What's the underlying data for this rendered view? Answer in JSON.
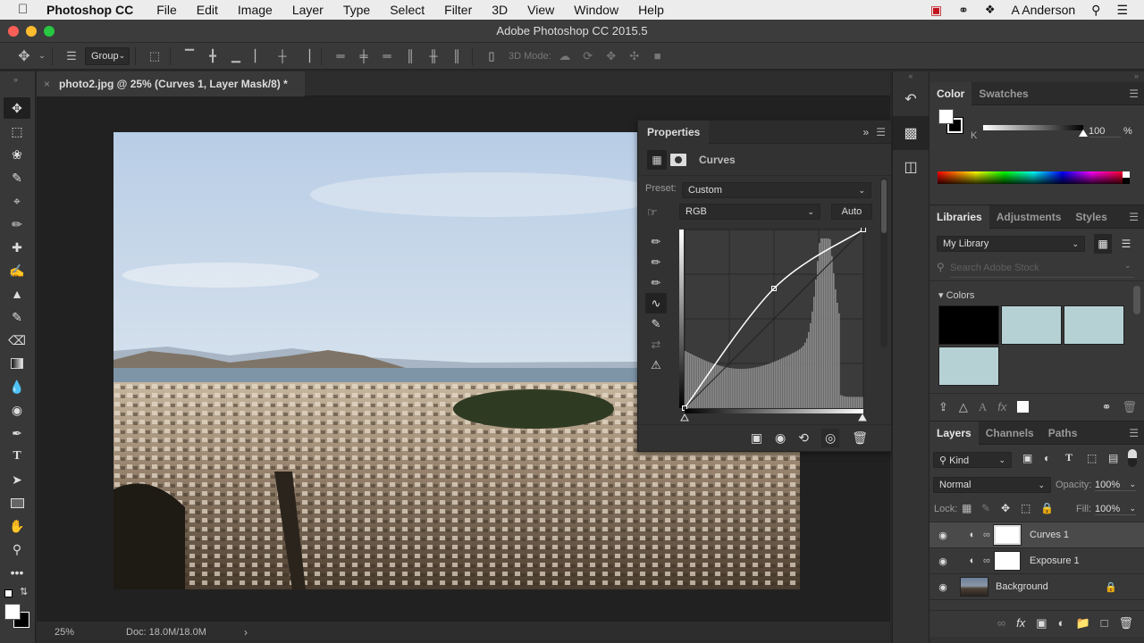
{
  "menubar": {
    "app": "Photoshop CC",
    "items": [
      "File",
      "Edit",
      "Image",
      "Layer",
      "Type",
      "Select",
      "Filter",
      "3D",
      "View",
      "Window",
      "Help"
    ],
    "user": "A Anderson"
  },
  "window": {
    "title": "Adobe Photoshop CC 2015.5"
  },
  "options_bar": {
    "auto_select_value": "Group",
    "mode3d_label": "3D Mode:"
  },
  "document": {
    "tab_title": "photo2.jpg @ 25% (Curves 1, Layer Mask/8) *",
    "zoom": "25%",
    "doc_size": "Doc: 18.0M/18.0M"
  },
  "properties": {
    "title": "Properties",
    "adjustment": "Curves",
    "preset_label": "Preset:",
    "preset_value": "Custom",
    "channel_value": "RGB",
    "auto_label": "Auto",
    "curve_points": [
      [
        0,
        0
      ],
      [
        0.5,
        0.67
      ],
      [
        1,
        1
      ]
    ]
  },
  "color_panel": {
    "tabs": [
      "Color",
      "Swatches"
    ],
    "channel_label": "K",
    "value": "100",
    "unit": "%",
    "k_level": 1.0,
    "foreground": "#ffffff",
    "background": "#000000"
  },
  "libraries_panel": {
    "tabs": [
      "Libraries",
      "Adjustments",
      "Styles"
    ],
    "library": "My Library",
    "search_placeholder": "Search Adobe Stock",
    "section": "Colors",
    "swatches": [
      "#000000",
      "#b6d1d4",
      "#b6d1d4",
      "#b6d1d4"
    ]
  },
  "layers_panel": {
    "tabs": [
      "Layers",
      "Channels",
      "Paths"
    ],
    "filter": "Kind",
    "blend_mode": "Normal",
    "opacity_label": "Opacity:",
    "opacity": "100%",
    "lock_label": "Lock:",
    "fill_label": "Fill:",
    "fill": "100%",
    "layers": [
      {
        "name": "Curves 1",
        "selected": true
      },
      {
        "name": "Exposure 1",
        "selected": false
      },
      {
        "name": "Background",
        "selected": false
      }
    ]
  }
}
